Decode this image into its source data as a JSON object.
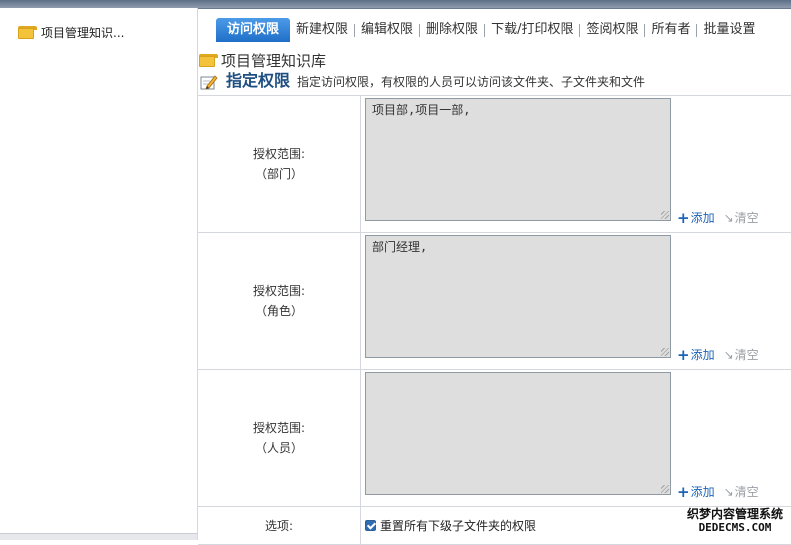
{
  "sidebar": {
    "tree_item_label": "项目管理知识..."
  },
  "tabs": [
    {
      "label": "访问权限",
      "active": true
    },
    {
      "label": "新建权限"
    },
    {
      "label": "编辑权限"
    },
    {
      "label": "删除权限"
    },
    {
      "label": "下载/打印权限"
    },
    {
      "label": "签阅权限"
    },
    {
      "label": "所有者"
    },
    {
      "label": "批量设置"
    }
  ],
  "breadcrumb": "项目管理知识库",
  "heading": {
    "title": "指定权限",
    "description": "指定访问权限，有权限的人员可以访问该文件夹、子文件夹和文件"
  },
  "scopes": [
    {
      "label": "授权范围:",
      "type": "（部门）",
      "value": "项目部,项目一部,",
      "add": "添加",
      "clear": "清空"
    },
    {
      "label": "授权范围:",
      "type": "（角色）",
      "value": "部门经理,",
      "add": "添加",
      "clear": "清空"
    },
    {
      "label": "授权范围:",
      "type": "（人员）",
      "value": "",
      "add": "添加",
      "clear": "清空"
    }
  ],
  "options": {
    "label": "选项:",
    "checkbox_label": "重置所有下级子文件夹的权限",
    "checked": true
  },
  "watermark": {
    "line1": "织梦内容管理系统",
    "line2": "DEDECMS.COM"
  },
  "colors": {
    "active_tab": "#2b7fd6",
    "heading": "#1f4f82",
    "link": "#1b64b8"
  }
}
